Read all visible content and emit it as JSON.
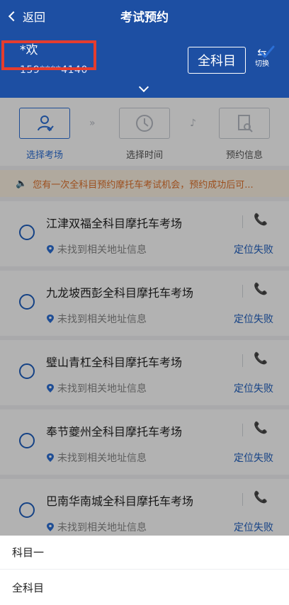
{
  "header": {
    "back_label": "返回",
    "title": "考试预约",
    "user_name": "*欢",
    "user_phone": "159****4140",
    "subject_button": "全科目",
    "switch_label": "切换"
  },
  "steps": [
    {
      "label": "选择考场",
      "icon": "user-check-icon",
      "active": true
    },
    {
      "label": "选择时间",
      "icon": "clock-icon",
      "active": false
    },
    {
      "label": "预约信息",
      "icon": "document-search-icon",
      "active": false
    }
  ],
  "notice": "您有一次全科目预约摩托车考试机会，预约成功后可...",
  "venues": [
    {
      "name": "江津双福全科目摩托车考场",
      "address": "未找到相关地址信息",
      "status": "定位失败"
    },
    {
      "name": "九龙坡西彭全科目摩托车考场",
      "address": "未找到相关地址信息",
      "status": "定位失败"
    },
    {
      "name": "璧山青杠全科目摩托车考场",
      "address": "未找到相关地址信息",
      "status": "定位失败"
    },
    {
      "name": "奉节夔州全科目摩托车考场",
      "address": "未找到相关地址信息",
      "status": "定位失败"
    },
    {
      "name": "巴南华南城全科目摩托车考场",
      "address": "未找到相关地址信息",
      "status": "定位失败"
    }
  ],
  "sheet": {
    "options": [
      "科目一",
      "全科目"
    ],
    "selected": "全科目"
  },
  "colors": {
    "header_bg": "#1d4fa3",
    "accent": "#2b6fd6",
    "notice_text": "#e0722c",
    "highlight": "#e53d2e"
  }
}
